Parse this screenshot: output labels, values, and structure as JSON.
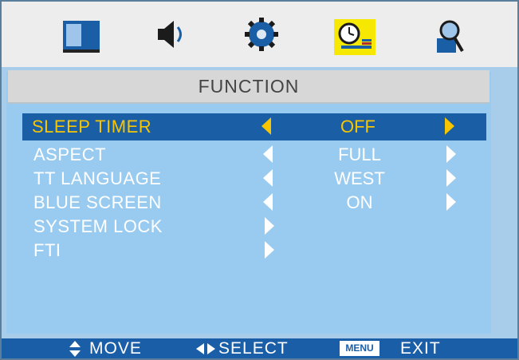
{
  "tabs": [
    {
      "name": "picture",
      "icon": "monitor-icon"
    },
    {
      "name": "sound",
      "icon": "speaker-icon"
    },
    {
      "name": "setup",
      "icon": "gear-icon"
    },
    {
      "name": "function",
      "icon": "clock-icon",
      "active": true
    },
    {
      "name": "search",
      "icon": "magnifier-icon"
    }
  ],
  "title": "FUNCTION",
  "menu": [
    {
      "label": "SLEEP TIMER",
      "value": "OFF",
      "selected": true,
      "has_left": true,
      "has_right": true
    },
    {
      "label": "ASPECT",
      "value": "FULL",
      "has_left": true,
      "has_right": true
    },
    {
      "label": "TT LANGUAGE",
      "value": "WEST",
      "has_left": true,
      "has_right": true
    },
    {
      "label": "BLUE SCREEN",
      "value": "ON",
      "has_left": true,
      "has_right": true
    },
    {
      "label": "SYSTEM LOCK",
      "value": "",
      "has_right_only": true
    },
    {
      "label": "FTI",
      "value": "",
      "has_right_only": true
    }
  ],
  "footer": {
    "move": "MOVE",
    "select": "SELECT",
    "menu_badge": "MENU",
    "exit": "EXIT"
  },
  "colors": {
    "highlight_text": "#f7c600",
    "selected_row": "#1a5ea6",
    "panel": "#99cbf0",
    "active_tab": "#f6e800"
  }
}
